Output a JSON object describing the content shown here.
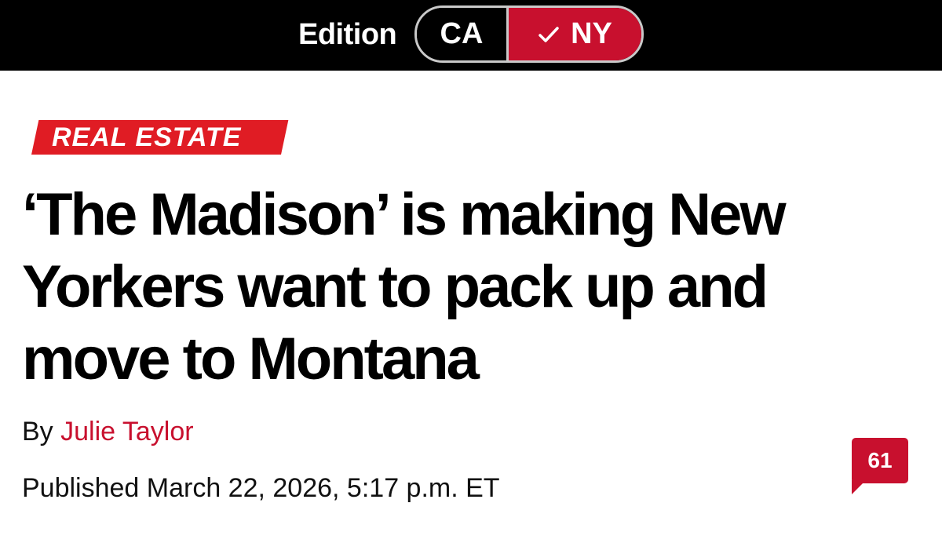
{
  "edition": {
    "label": "Edition",
    "options": [
      {
        "label": "CA",
        "selected": false
      },
      {
        "label": "NY",
        "selected": true
      }
    ],
    "selected_icon": "check-icon"
  },
  "article": {
    "section_tag": "REAL ESTATE",
    "headline": "‘The Madison’ is making New Yorkers want to pack up and move to Montana",
    "byline_prefix": "By",
    "author": "Julie Taylor",
    "published": "Published March 22, 2026, 5:17 p.m. ET",
    "comment_count": "61"
  },
  "colors": {
    "brand_red": "#c8102e",
    "tag_red": "#e01c24",
    "top_bar": "#000000"
  }
}
